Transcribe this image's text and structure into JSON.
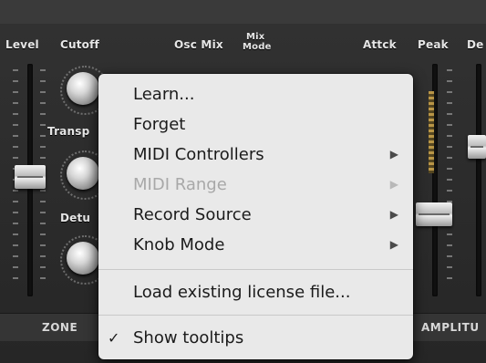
{
  "synth": {
    "labels": {
      "level": "Level",
      "cutoff": "Cutoff",
      "osc_mix": "Osc Mix",
      "mix_mode_line1": "Mix",
      "mix_mode_line2": "Mode",
      "attack": "Attck",
      "peak": "Peak",
      "decay_partial": "De",
      "transpose_partial": "Transp",
      "detune_partial": "Detu"
    },
    "sections": {
      "zone": "ZONE",
      "amplitude_partial": "AMPLITU"
    }
  },
  "context_menu": {
    "items": [
      {
        "label": "Learn...",
        "enabled": true,
        "submenu": false
      },
      {
        "label": "Forget",
        "enabled": true,
        "submenu": false
      },
      {
        "label": "MIDI Controllers",
        "enabled": true,
        "submenu": true
      },
      {
        "label": "MIDI Range",
        "enabled": false,
        "submenu": true
      },
      {
        "label": "Record Source",
        "enabled": true,
        "submenu": true
      },
      {
        "label": "Knob Mode",
        "enabled": true,
        "submenu": true
      }
    ],
    "license_item": "Load existing license file...",
    "tooltips_item": {
      "label": "Show tooltips",
      "checked": true,
      "check_glyph": "✓"
    },
    "submenu_arrow": "▶"
  }
}
